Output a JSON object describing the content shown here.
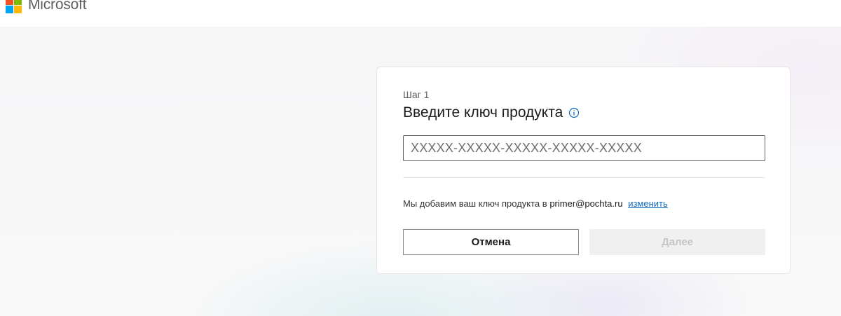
{
  "header": {
    "brand": "Microsoft",
    "logo_colors": [
      "#f25022",
      "#7fba00",
      "#00a4ef",
      "#ffb900"
    ]
  },
  "card": {
    "step": "Шаг 1",
    "title": "Введите ключ продукта",
    "info_icon": "info-icon",
    "key_input": {
      "value": "",
      "placeholder": "XXXXX-XXXXX-XXXXX-XXXXX-XXXXX"
    },
    "note": {
      "prefix": "Мы добавим ваш ключ продукта в",
      "email": "primer@pochta.ru",
      "change_link": "изменить"
    },
    "buttons": {
      "cancel": "Отмена",
      "next": "Далее"
    }
  },
  "colors": {
    "accent": "#0f6cbd",
    "disabled_bg": "#f0f0f0",
    "disabled_text": "#c4c4c4"
  }
}
